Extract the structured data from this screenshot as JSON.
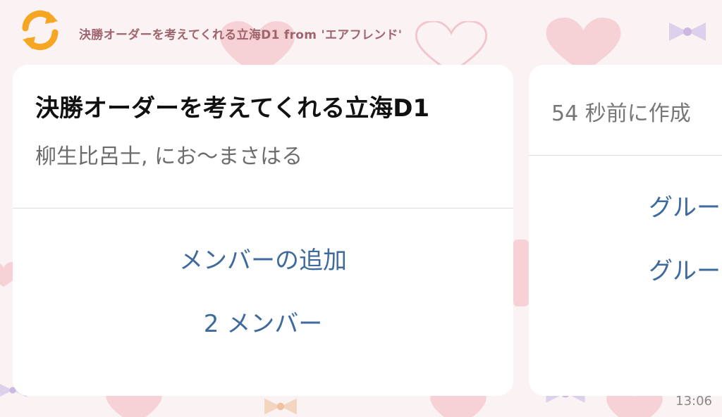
{
  "notification": {
    "app_icon": "refresh-sync-icon",
    "title": "決勝オーダーを考えてくれる立海D1 from 'エアフレンド'"
  },
  "card_main": {
    "title": "決勝オーダーを考えてくれる立海D1",
    "members_text": "柳生比呂士, にお〜まさはる",
    "add_member_label": "メンバーの追加",
    "member_count_label": "2 メンバー"
  },
  "card_second": {
    "created_text": "54 秒前に作成",
    "group_action_1": "グルー",
    "group_action_2": "グルー"
  },
  "status": {
    "time": "13:06"
  },
  "colors": {
    "accent_blue": "#3f6a9e",
    "icon_orange": "#f5a623",
    "background": "#fbf2f3"
  }
}
